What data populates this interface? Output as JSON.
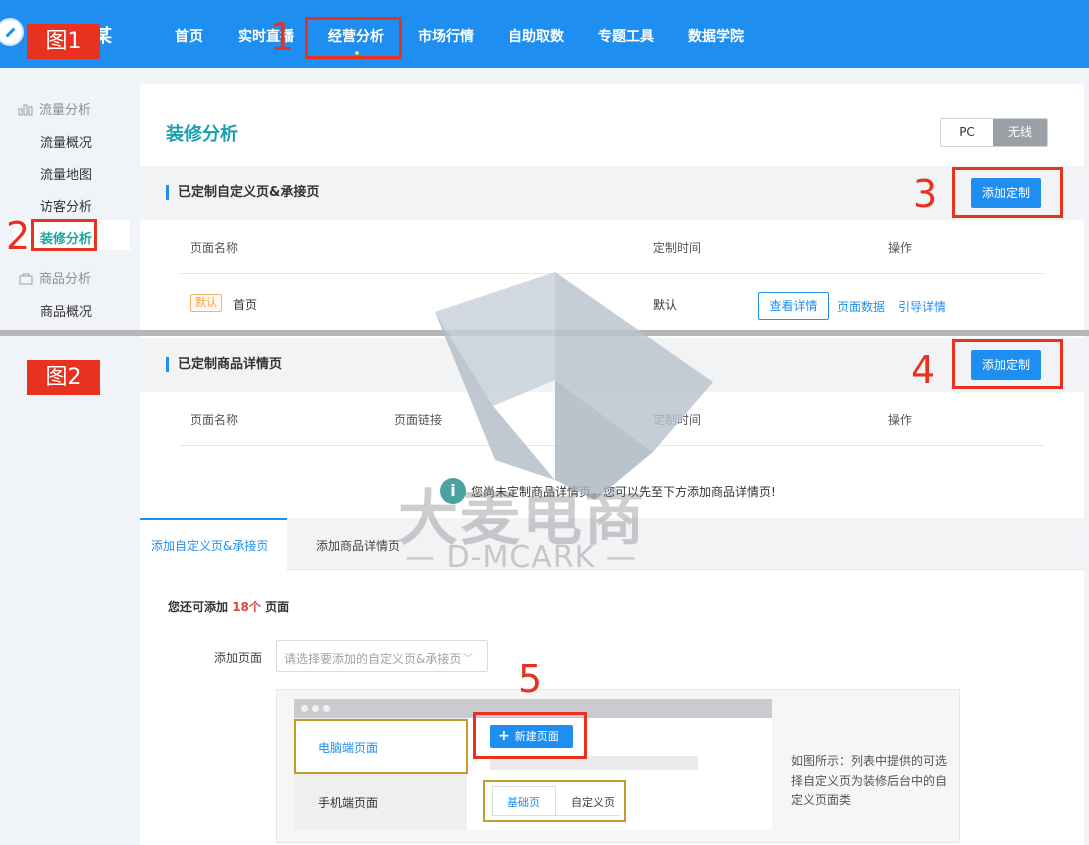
{
  "brand": {
    "logo_char": "某"
  },
  "nav": {
    "items": [
      "首页",
      "实时直播",
      "经营分析",
      "市场行情",
      "自助取数",
      "专题工具",
      "数据学院"
    ],
    "active": "经营分析"
  },
  "sidebar": {
    "group1": "流量分析",
    "items1": [
      "流量概况",
      "流量地图",
      "访客分析"
    ],
    "active": "装修分析",
    "group2": "商品分析",
    "items2": [
      "商品概况"
    ]
  },
  "page": {
    "title": "装修分析",
    "device_toggle": {
      "options": [
        "PC",
        "无线"
      ],
      "selected": "无线"
    }
  },
  "section1": {
    "title": "已定制自定义页&承接页",
    "add_button": "添加定制",
    "columns": [
      "页面名称",
      "定制时间",
      "操作"
    ],
    "rows": [
      {
        "tag": "默认",
        "name": "首页",
        "time": "默认",
        "actions": [
          "查看详情",
          "页面数据",
          "引导详情"
        ]
      }
    ]
  },
  "section2": {
    "title": "已定制商品详情页",
    "add_button": "添加定制",
    "columns": [
      "页面名称",
      "页面链接",
      "定制时间",
      "操作"
    ],
    "empty_notice": "您尚未定制商品详情页，您可以先至下方添加商品详情页!"
  },
  "tabs": [
    "添加自定义页&承接页",
    "添加商品详情页"
  ],
  "add_form": {
    "remain_prefix": "您还可添加 ",
    "remain_count": "18个",
    "remain_suffix": " 页面",
    "label": "添加页面",
    "select_placeholder": "请选择要添加的自定义页&承接页"
  },
  "demo": {
    "left_items": [
      "电脑端页面",
      "手机端页面"
    ],
    "new_button": "新建页面",
    "tabs": [
      "基础页",
      "自定义页"
    ],
    "note": "如图所示：列表中提供的可选择自定义页为装修后台中的自定义页面类"
  },
  "annotations": {
    "fig1": "图1",
    "fig2": "图2",
    "markers": [
      "1",
      "2",
      "3",
      "4",
      "5"
    ]
  },
  "watermark": {
    "main": "大麦电商",
    "sub": "— D-MCARK —"
  },
  "colors": {
    "nav_blue": "#1e8ff0",
    "accent_teal": "#1aa79d",
    "annotation_red": "#e8321f"
  }
}
